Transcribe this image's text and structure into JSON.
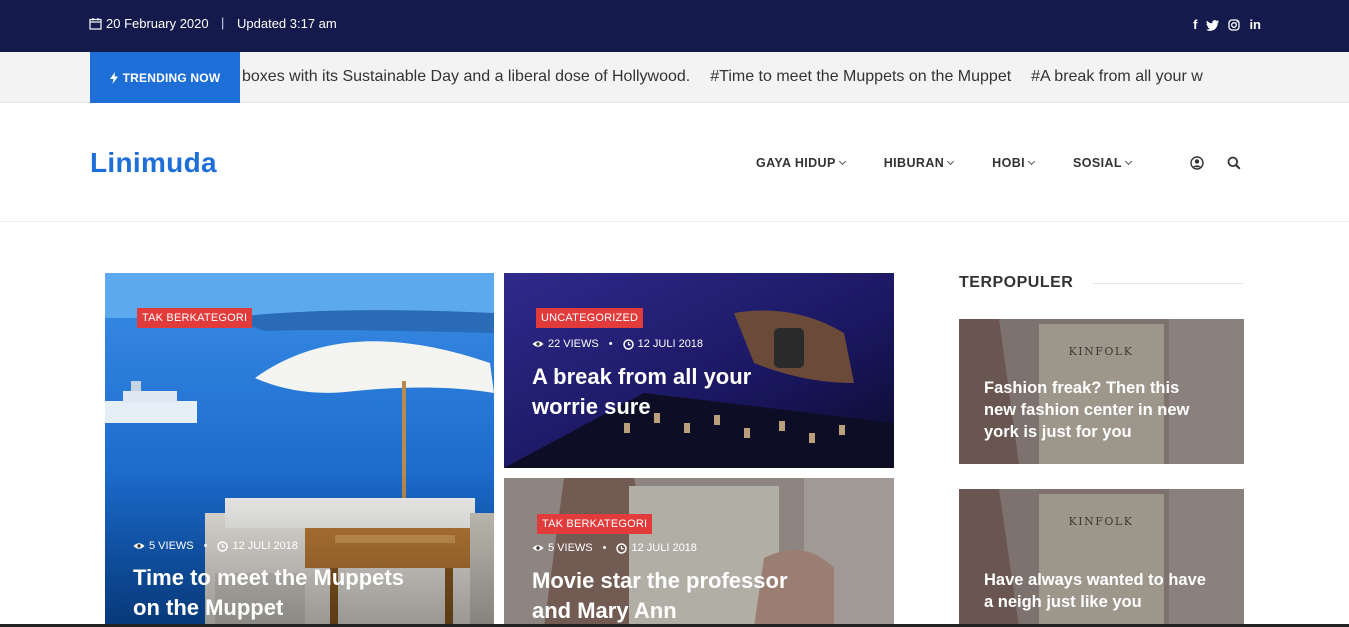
{
  "topbar": {
    "date": "20 February 2020",
    "separator": "|",
    "updated": "Updated 3:17 am",
    "social": [
      "facebook-icon",
      "twitter-icon",
      "instagram-icon",
      "linkedin-icon"
    ]
  },
  "trending": {
    "label": "TRENDING NOW",
    "items": [
      "boxes with its Sustainable Day and a liberal dose of Hollywood.",
      "#Time to meet the Muppets on the Muppet",
      "#A break from all your w"
    ]
  },
  "header": {
    "logo": "Linimuda",
    "nav": [
      "GAYA HIDUP",
      "HIBURAN",
      "HOBI",
      "SOSIAL"
    ]
  },
  "cards": [
    {
      "category": "TAK BERKATEGORI",
      "views": "5 VIEWS",
      "date": "12 JULI 2018",
      "title_line1": "Time to meet the Muppets",
      "title_line2": "on the Muppet"
    },
    {
      "category": "UNCATEGORIZED",
      "views": "22 VIEWS",
      "date": "12 JULI 2018",
      "title_line1": "A break from all your",
      "title_line2": "worrie sure"
    },
    {
      "category": "TAK BERKATEGORI",
      "views": "5 VIEWS",
      "date": "12 JULI 2018",
      "title_line1": "Movie star the professor",
      "title_line2": "and Mary Ann"
    }
  ],
  "sidebar": {
    "heading": "TERPOPULER",
    "items": [
      {
        "image_text": "KINFOLK",
        "line1": "Fashion freak? Then this",
        "line2": "new fashion center in new",
        "line3": "york is just for you"
      },
      {
        "image_text": "KINFOLK",
        "line1": "Have always wanted to have",
        "line2": "a neigh just like you"
      }
    ]
  },
  "colors": {
    "topbar": "#141a4b",
    "accent": "#1e6ed8",
    "category": "#e23b3b"
  }
}
